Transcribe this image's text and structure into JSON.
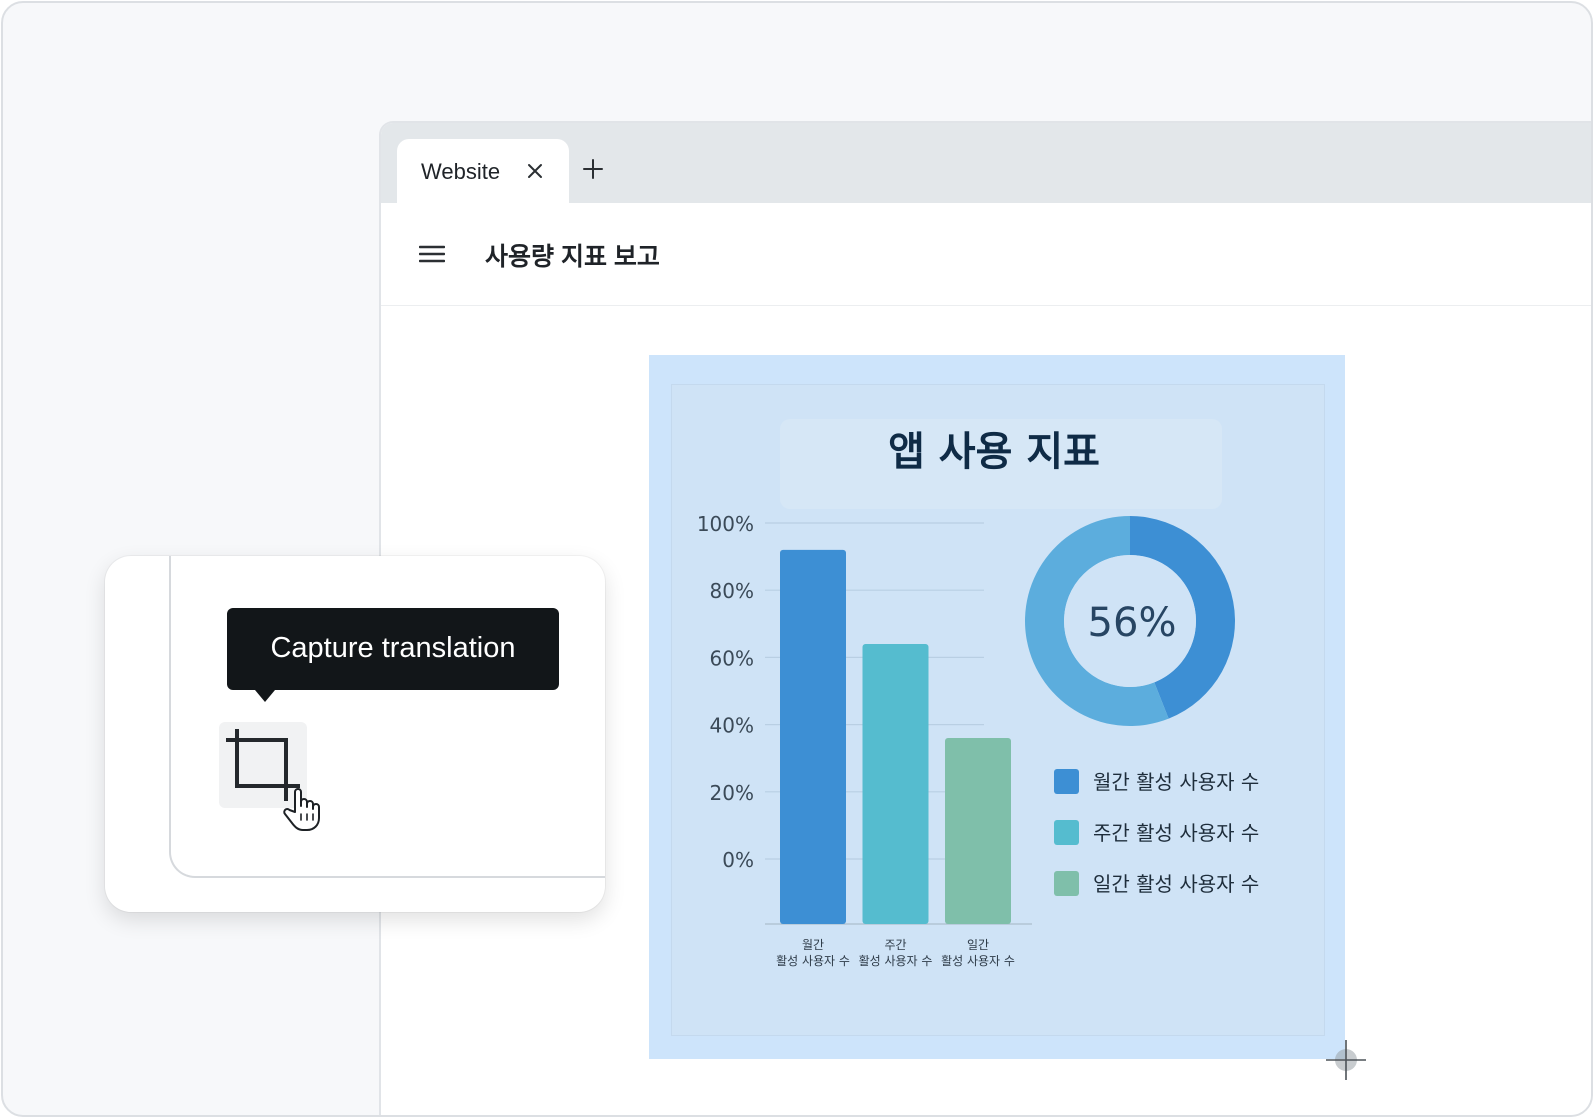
{
  "browser": {
    "tab_title": "Website",
    "page_title": "사용량 지표 보고"
  },
  "popup": {
    "tooltip_text": "Capture translation"
  },
  "colors": {
    "monthly": "#3d8fd4",
    "weekly": "#55bccf",
    "daily": "#7fbfaa",
    "selection": "#cde4fb"
  },
  "chart_data": {
    "title": "앱 사용 지표",
    "bar": {
      "type": "bar",
      "categories": [
        [
          "월간",
          "활성 사용자 수"
        ],
        [
          "주간",
          "활성 사용자 수"
        ],
        [
          "일간",
          "활성 사용자 수"
        ]
      ],
      "values": [
        92,
        64,
        36
      ],
      "y_ticks": [
        "100%",
        "80%",
        "60%",
        "40%",
        "20%",
        "0%"
      ],
      "ylim": [
        0,
        100
      ],
      "grid": true
    },
    "donut": {
      "type": "pie",
      "center_label": "56%",
      "segments": [
        {
          "name": "월간 활성 사용자 수",
          "value": 44
        },
        {
          "name": "주간 활성 사용자 수",
          "value": 56
        }
      ]
    },
    "legend": [
      "월간 활성 사용자 수",
      "주간 활성 사용자 수",
      "일간 활성 사용자 수"
    ]
  }
}
